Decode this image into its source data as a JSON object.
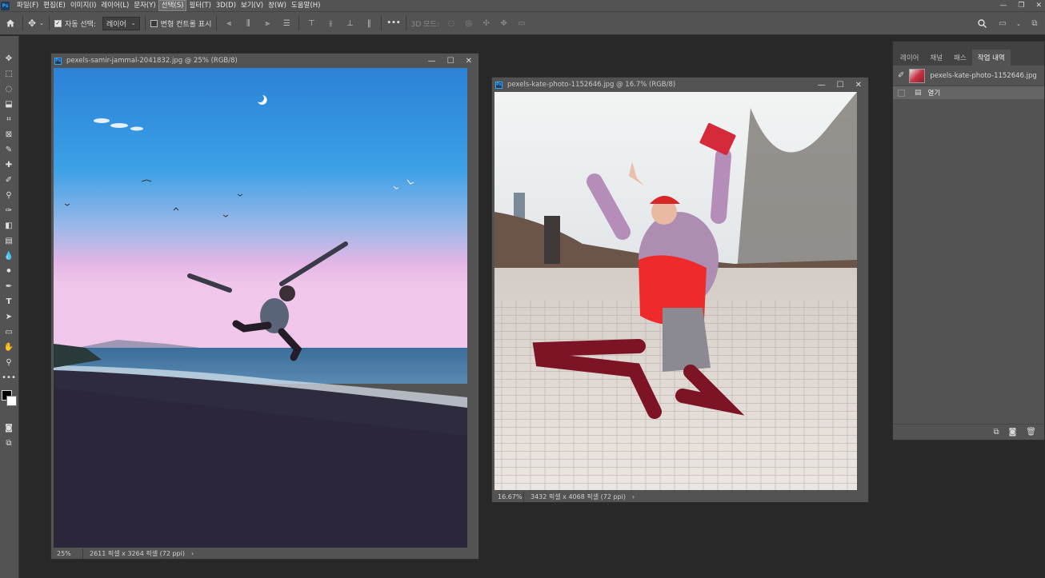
{
  "app": {
    "logo": "Ps"
  },
  "menu": [
    "파일(F)",
    "편집(E)",
    "이미지(I)",
    "레이어(L)",
    "문자(Y)",
    "선택(S)",
    "필터(T)",
    "3D(D)",
    "보기(V)",
    "창(W)",
    "도움말(H)"
  ],
  "menu_active_index": 5,
  "options": {
    "auto_select_label": "자동 선택:",
    "auto_select_value": "레이어",
    "transform_label": "변형 컨트롤 표시",
    "mode_3d_label": "3D 모드:",
    "more": "•••"
  },
  "doc1": {
    "title": "pexels-samir-jammal-2041832.jpg @ 25% (RGB/8)",
    "zoom": "25%",
    "dims": "2611 픽셀 x 3264 픽셀 (72 ppi)"
  },
  "doc2": {
    "title": "pexels-kate-photo-1152646.jpg @ 16.7% (RGB/8)",
    "zoom": "16.67%",
    "dims": "3432 픽셀 x 4068 픽셀 (72 ppi)"
  },
  "panel": {
    "tabs": [
      "레이어",
      "채널",
      "패스",
      "작업 내역"
    ],
    "active_tab": 3,
    "snapshot_name": "pexels-kate-photo-1152646.jpg",
    "history_items": [
      "열기"
    ]
  },
  "colors": {
    "accent": "#31a8ff",
    "ui_bg": "#535353",
    "workspace": "#282828"
  }
}
